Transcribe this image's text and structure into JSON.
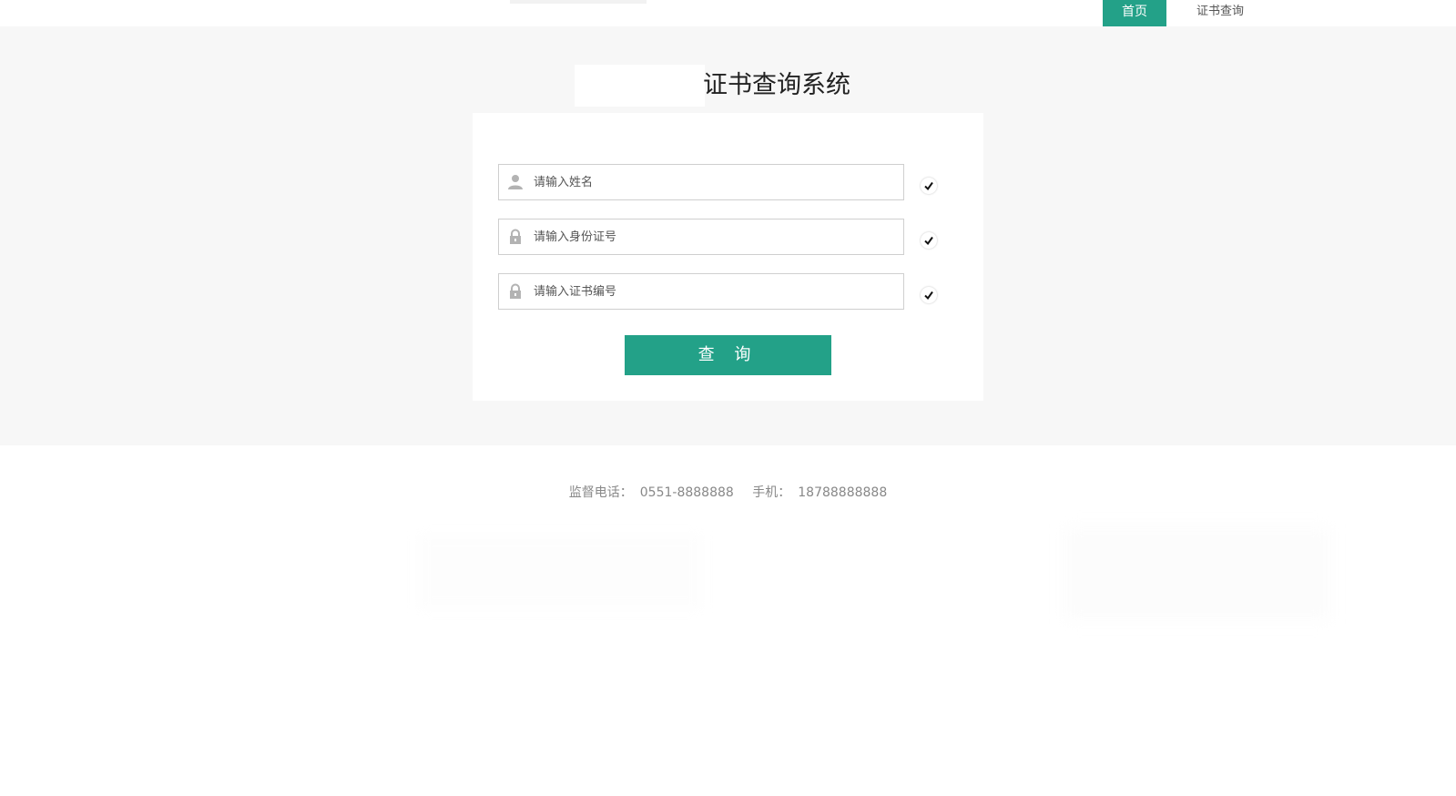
{
  "nav": {
    "home_label": "首页",
    "cert_query_label": "证书查询"
  },
  "page": {
    "title": "证书查询系统"
  },
  "form": {
    "name_placeholder": "请输入姓名",
    "id_placeholder": "请输入身份证号",
    "cert_no_placeholder": "请输入证书编号",
    "submit_label": "查 询"
  },
  "footer": {
    "supervision_label": "监督电话：",
    "supervision_phone": "0551-8888888",
    "mobile_label": "手机：",
    "mobile_phone": "18788888888"
  },
  "icons": {
    "user": "user-icon",
    "lock": "lock-icon",
    "check": "check-icon"
  },
  "colors": {
    "accent": "#23a188",
    "band_background": "#f7f7f7",
    "footer_text": "#888888"
  }
}
